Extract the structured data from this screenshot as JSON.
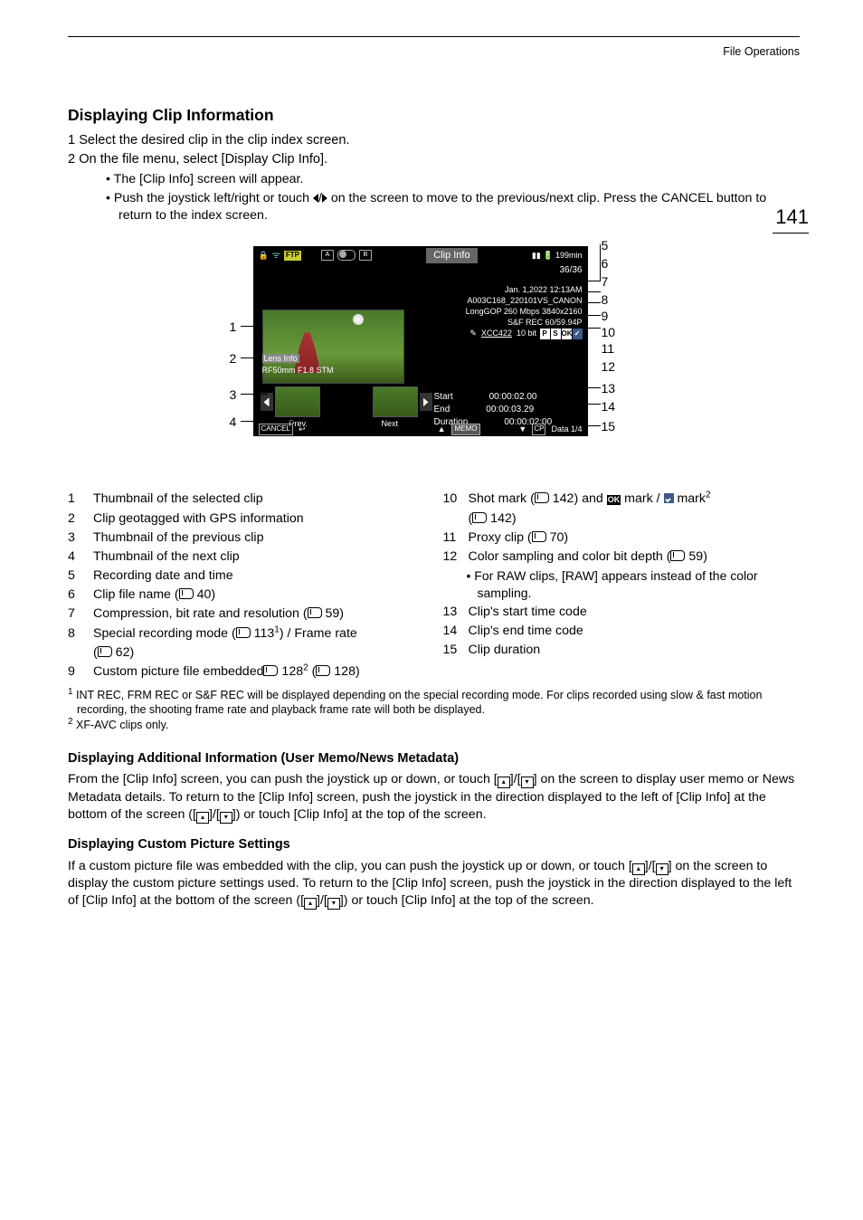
{
  "running_head": "File Operations",
  "page_number": "141",
  "h_main": "Displaying Clip Information",
  "steps": [
    "Select the desired clip in the clip index screen.",
    "On the file menu, select [Display Clip Info]."
  ],
  "sub": {
    "a": "The [Clip Info] screen will appear.",
    "b1": "Push the joystick left/right or touch ",
    "b2": " on the screen to move to the previous/next clip. Press the CANCEL button to return to the index screen."
  },
  "screen": {
    "title": "Clip Info",
    "ftp": "FTP",
    "cardA": "A",
    "cardB": "B",
    "batt_time": "199min",
    "count": "36/36",
    "date": "Jan. 1,2022 12:13AM",
    "clipname": "A003C168_220101VS_CANON",
    "codec": "LongGOP 260 Mbps   3840x2160",
    "rec": "S&F REC    60/59.94P",
    "sampling": "XCC422",
    "bit": "10 bit",
    "lens_hdr": "Lens Info",
    "lens_val": "RF50mm F1.8 STM",
    "prev": "Prev.",
    "next": "Next",
    "start_l": "Start",
    "start_v": "00:00:02.00",
    "end_l": "End",
    "end_v": "00:00:03.29",
    "dur_l": "Duration",
    "dur_v": "00:00:02:00",
    "cancel": "CANCEL",
    "memo": "MEMO",
    "data": "Data 1/4"
  },
  "legend_left": [
    {
      "n": "1",
      "t": "Thumbnail of the selected clip"
    },
    {
      "n": "2",
      "t": "Clip geotagged with GPS information"
    },
    {
      "n": "3",
      "t": "Thumbnail of the previous clip"
    },
    {
      "n": "4",
      "t": "Thumbnail of the next clip"
    },
    {
      "n": "5",
      "t": "Recording date and time"
    },
    {
      "n": "6",
      "t": "Clip file name (",
      "ref": "40",
      "tail": ")"
    },
    {
      "n": "7",
      "t": "Compression, bit rate and resolution (",
      "ref": "59",
      "tail": ")"
    },
    {
      "n": "8",
      "t": "Special recording mode (",
      "ref": "113",
      "tail": ") / Frame rate",
      "sup": "1",
      "cont": "(",
      "ref2": "62",
      "tail2": ")"
    },
    {
      "n": "9",
      "t": "Custom picture file embedded",
      "sup": "2",
      "after": " (",
      "ref": "128",
      "tail": ")"
    }
  ],
  "legend_right": [
    {
      "n": "10",
      "t": "Shot mark (",
      "ref": "142",
      "mid": ") and ",
      "mid2": " mark / ",
      "mid3": " mark",
      "sup": "2",
      "cont": "(",
      "ref2": "142",
      "tail2": ")"
    },
    {
      "n": "11",
      "t": "Proxy clip (",
      "ref": "70",
      "tail": ")"
    },
    {
      "n": "12",
      "t": "Color sampling and color bit depth (",
      "ref": "59",
      "tail": ")",
      "bullet": "For RAW clips, [RAW] appears instead of the color sampling."
    },
    {
      "n": "13",
      "t": "Clip's start time code"
    },
    {
      "n": "14",
      "t": "Clip's end time code"
    },
    {
      "n": "15",
      "t": "Clip duration"
    }
  ],
  "fn1_sup": "1",
  "fn1": " INT REC, FRM REC or S&F REC will be displayed depending on the special recording mode. For clips recorded using slow & fast motion recording, the shooting frame rate and playback frame rate will both be displayed.",
  "fn2_sup": "2",
  "fn2": " XF-AVC clips only.",
  "h_add": "Displaying Additional Information (User Memo/News Metadata)",
  "p_add_a": "From the [Clip Info] screen, you can push the joystick up or down, or touch [",
  "p_add_b": "]/[",
  "p_add_c": "] on the screen to display user memo or News Metadata details. To return to the [Clip Info] screen, push the joystick in the direction displayed to the left of [Clip Info] at the bottom of the screen ([",
  "p_add_d": "]/[",
  "p_add_e": "]) or touch [Clip Info] at the top of the screen.",
  "h_cp": "Displaying Custom Picture Settings",
  "p_cp_a": "If a custom picture file was embedded with the clip, you can push the joystick up or down, or touch [",
  "p_cp_b": "]/[",
  "p_cp_c": "] on the screen to display the custom picture settings used. To return to the [Clip Info] screen, push the joystick in the direction displayed to the left of [Clip Info] at the bottom of the screen ([",
  "p_cp_d": "]/[",
  "p_cp_e": "]) or touch [Clip Info] at the top of the screen."
}
